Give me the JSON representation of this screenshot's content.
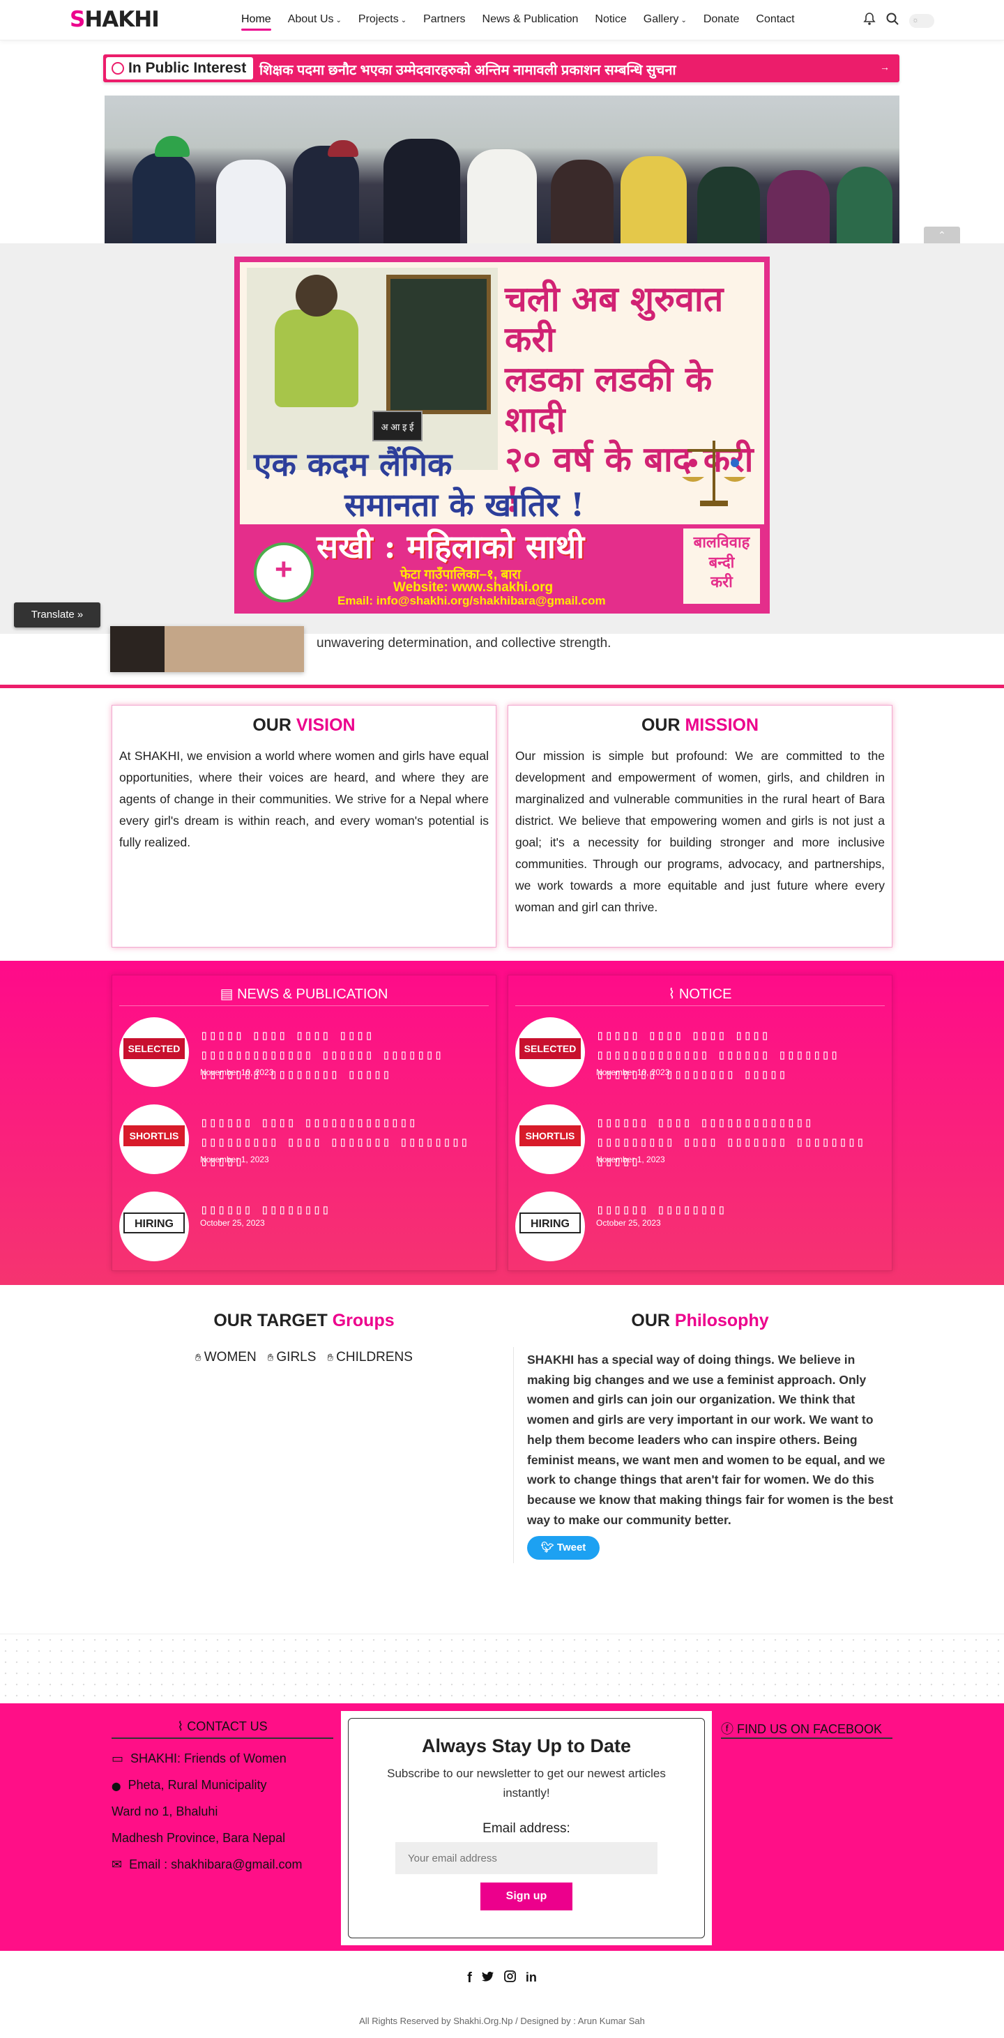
{
  "header": {
    "logo_first": "S",
    "logo_rest": "HAKHI",
    "nav": [
      {
        "label": "Home",
        "dropdown": false,
        "active": true
      },
      {
        "label": "About Us",
        "dropdown": true,
        "active": false
      },
      {
        "label": "Projects",
        "dropdown": true,
        "active": false
      },
      {
        "label": "Partners",
        "dropdown": false,
        "active": false
      },
      {
        "label": "News & Publication",
        "dropdown": false,
        "active": false
      },
      {
        "label": "Notice",
        "dropdown": false,
        "active": false
      },
      {
        "label": "Gallery",
        "dropdown": true,
        "active": false
      },
      {
        "label": "Donate",
        "dropdown": false,
        "active": false
      },
      {
        "label": "Contact",
        "dropdown": false,
        "active": false
      }
    ],
    "icons": [
      "bell-icon",
      "search-icon",
      "theme-toggle"
    ]
  },
  "ticker": {
    "label": "In Public Interest",
    "text": "शिक्षक पदमा छनौट भएका उम्मेदवारहरुको अन्तिम नामावली प्रकाशन सम्बन्धि सुचना"
  },
  "poster": {
    "headline": [
      "चली अब शुरुवात करी",
      "लडका लडकी के शादी",
      "२० वर्ष के बाद करी !"
    ],
    "slogan": [
      "एक कदम लैंगिक",
      "समानता के खातिर !"
    ],
    "org": "सखी : महिलाको साथी",
    "address": "फेटा गाउँपालिका–१, बारा",
    "website": "Website: www.shakhi.org",
    "email": "Email: info@shakhi.org/shakhibara@gmail.com",
    "side": [
      "बालविवाह",
      "बन्दी",
      "करी"
    ],
    "slate": "अ आ इ ई"
  },
  "translate_label": "Translate »",
  "about_fragment": "unwavering determination, and collective strength.",
  "vision": {
    "title_a": "OUR",
    "title_b": "VISION",
    "text": "At SHAKHI, we envision a world where women and girls have equal opportunities, where their voices are heard, and where they are agents of change in their communities. We strive for a Nepal where every girl's dream is within reach, and every woman's potential is fully realized."
  },
  "mission": {
    "title_a": "OUR",
    "title_b": "MISSION",
    "text": "Our mission is simple but profound: We are committed to the development and empowerment of women, girls, and children in marginalized and vulnerable communities in the rural heart of Bara district. We believe that empowering women and girls is not just a goal; it's a necessity for building stronger and more inclusive communities. Through our programs, advocacy, and partnerships, we work towards a more equitable and just future where every woman and girl can thrive."
  },
  "news": {
    "title": "NEWS & PUBLICATION",
    "items": [
      {
        "badge": "SELECTED",
        "title": "▯▯▯▯▯ ▯▯▯▯ ▯▯▯▯ ▯▯▯▯ ▯▯▯▯▯▯▯▯▯▯▯▯▯ ▯▯▯▯▯▯ ▯▯▯▯▯▯▯ ▯▯▯▯▯▯▯ ▯▯▯▯▯▯▯▯ ▯▯▯▯▯",
        "date": "November 10, 2023"
      },
      {
        "badge": "SHORTLIS",
        "title": "▯▯▯▯▯▯ ▯▯▯▯ ▯▯▯▯▯▯▯▯▯▯▯▯▯ ▯▯▯▯▯▯▯▯▯ ▯▯▯▯ ▯▯▯▯▯▯▯ ▯▯▯▯▯▯▯▯ ▯▯▯▯▯",
        "date": "November 1, 2023"
      },
      {
        "badge": "HIRING",
        "title": "▯▯▯▯▯▯ ▯▯▯▯▯▯▯▯",
        "date": "October 25, 2023"
      }
    ]
  },
  "notice": {
    "title": "NOTICE",
    "items": [
      {
        "badge": "SELECTED",
        "title": "▯▯▯▯▯ ▯▯▯▯ ▯▯▯▯ ▯▯▯▯ ▯▯▯▯▯▯▯▯▯▯▯▯▯ ▯▯▯▯▯▯ ▯▯▯▯▯▯▯ ▯▯▯▯▯▯▯ ▯▯▯▯▯▯▯▯ ▯▯▯▯▯",
        "date": "November 10, 2023"
      },
      {
        "badge": "SHORTLIS",
        "title": "▯▯▯▯▯▯ ▯▯▯▯ ▯▯▯▯▯▯▯▯▯▯▯▯▯ ▯▯▯▯▯▯▯▯▯ ▯▯▯▯ ▯▯▯▯▯▯▯ ▯▯▯▯▯▯▯▯ ▯▯▯▯▯",
        "date": "November 1, 2023"
      },
      {
        "badge": "HIRING",
        "title": "▯▯▯▯▯▯ ▯▯▯▯▯▯▯▯",
        "date": "October 25, 2023"
      }
    ]
  },
  "target": {
    "title_a": "OUR TARGET",
    "title_b": "Groups",
    "groups": [
      "WOMEN",
      "GIRLS",
      "CHILDRENS"
    ]
  },
  "philosophy": {
    "title_a": "OUR",
    "title_b": "Philosophy",
    "text": "SHAKHI has a special way of doing things. We believe in making big changes and we use a feminist approach. Only women and girls can join our organization. We think that women and girls are very important in our work. We want to help them become leaders who can inspire others. Being feminist means, we want men and women to be equal, and we work to change things that aren't fair for women. We do this because we know that making things fair for women is the best way to make our community better.",
    "tweet_label": "Tweet"
  },
  "footer": {
    "contact_title": "CONTACT US",
    "contact_lines": [
      {
        "icon": "id-card-icon",
        "text": "SHAKHI: Friends of Women"
      },
      {
        "icon": "map-pin-icon",
        "text": "Pheta, Rural Municipality"
      },
      {
        "icon": "",
        "text": "Ward no 1, Bhaluhi"
      },
      {
        "icon": "",
        "text": "Madhesh Province, Bara Nepal"
      },
      {
        "icon": "mail-icon",
        "text": "Email : shakhibara@gmail.com"
      }
    ],
    "newsletter": {
      "title": "Always Stay Up to Date",
      "subtitle": "Subscribe to our newsletter to get our newest articles instantly!",
      "email_label": "Email address:",
      "email_placeholder": "Your email address",
      "button": "Sign up"
    },
    "facebook_title": "FIND US ON FACEBOOK",
    "social": [
      "facebook-icon",
      "twitter-icon",
      "instagram-icon",
      "linkedin-icon"
    ],
    "copyright": "All Rights Reserved by Shakhi.Org.Np / Designed by : Arun Kumar Sah"
  },
  "colors": {
    "accent": "#ec008c",
    "ticker": "#ec1d6b",
    "footer": "#ff0f87",
    "tweet": "#1da1f2"
  }
}
